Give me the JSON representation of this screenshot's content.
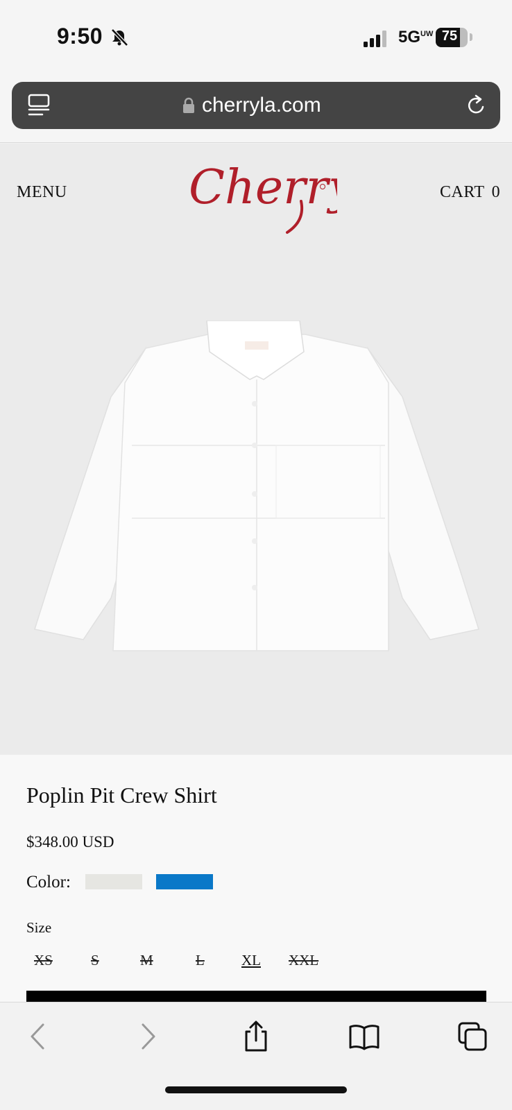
{
  "status_bar": {
    "time": "9:50",
    "network": "5G",
    "network_suffix": "UW",
    "battery_level": "75",
    "battery_fraction": 0.75,
    "icons": [
      "bell-slash-icon",
      "signal-icon",
      "battery-icon"
    ]
  },
  "browser": {
    "url": "cherryla.com",
    "icons": [
      "reader-icon",
      "lock-icon",
      "reload-icon"
    ]
  },
  "site_header": {
    "menu_label": "MENU",
    "logo_text": "Cherry",
    "cart_label": "CART",
    "cart_count": "0",
    "brand_color": "#b01f2a"
  },
  "product": {
    "title": "Poplin Pit Crew Shirt",
    "price": "$348.00 USD",
    "color_label": "Color:",
    "colors": [
      {
        "name": "white",
        "hex": "#e6e6e2"
      },
      {
        "name": "blue",
        "hex": "#0a78c8"
      }
    ],
    "size_label": "Size",
    "sizes": [
      {
        "label": "XS",
        "available": false
      },
      {
        "label": "S",
        "available": false
      },
      {
        "label": "M",
        "available": false
      },
      {
        "label": "L",
        "available": false
      },
      {
        "label": "XL",
        "available": true
      },
      {
        "label": "XXL",
        "available": false
      }
    ]
  },
  "toolbar": {
    "icons": [
      "back-icon",
      "forward-icon",
      "share-icon",
      "bookmarks-icon",
      "tabs-icon"
    ]
  }
}
